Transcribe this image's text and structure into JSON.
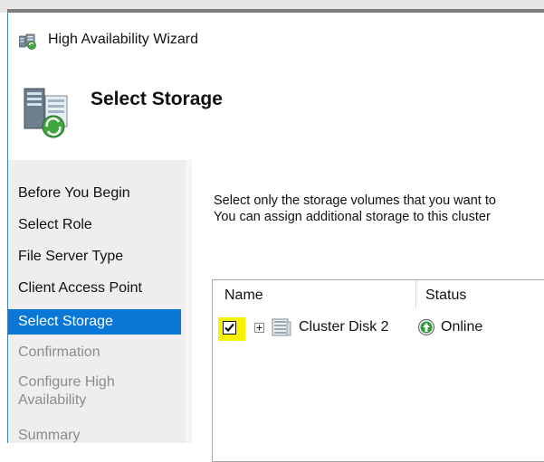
{
  "window": {
    "title": "High Availability Wizard",
    "page_heading": "Select Storage"
  },
  "nav": {
    "items": [
      {
        "label": "Before You Begin",
        "state": "normal"
      },
      {
        "label": "Select Role",
        "state": "normal"
      },
      {
        "label": "File Server Type",
        "state": "normal"
      },
      {
        "label": "Client Access Point",
        "state": "normal"
      },
      {
        "label": "Select Storage",
        "state": "selected"
      },
      {
        "label": "Confirmation",
        "state": "disabled"
      },
      {
        "label": "Configure High Availability",
        "state": "disabled"
      },
      {
        "label": "Summary",
        "state": "disabled"
      }
    ]
  },
  "content": {
    "instruction_line1": "Select only the storage volumes that you want to",
    "instruction_line2": "You can assign additional storage to this cluster"
  },
  "storage_list": {
    "columns": {
      "name": "Name",
      "status": "Status"
    },
    "rows": [
      {
        "name": "Cluster Disk 2",
        "status": "Online",
        "checked": true,
        "highlighted": true
      }
    ]
  },
  "colors": {
    "selection_blue": "#0a77d6",
    "highlight_yellow": "#f7f200",
    "status_green": "#2e9b3a"
  },
  "icons": [
    "wizard-icon",
    "storage-header-icon",
    "checkbox-checked-icon",
    "expand-plus-icon",
    "disk-icon",
    "online-status-icon"
  ]
}
